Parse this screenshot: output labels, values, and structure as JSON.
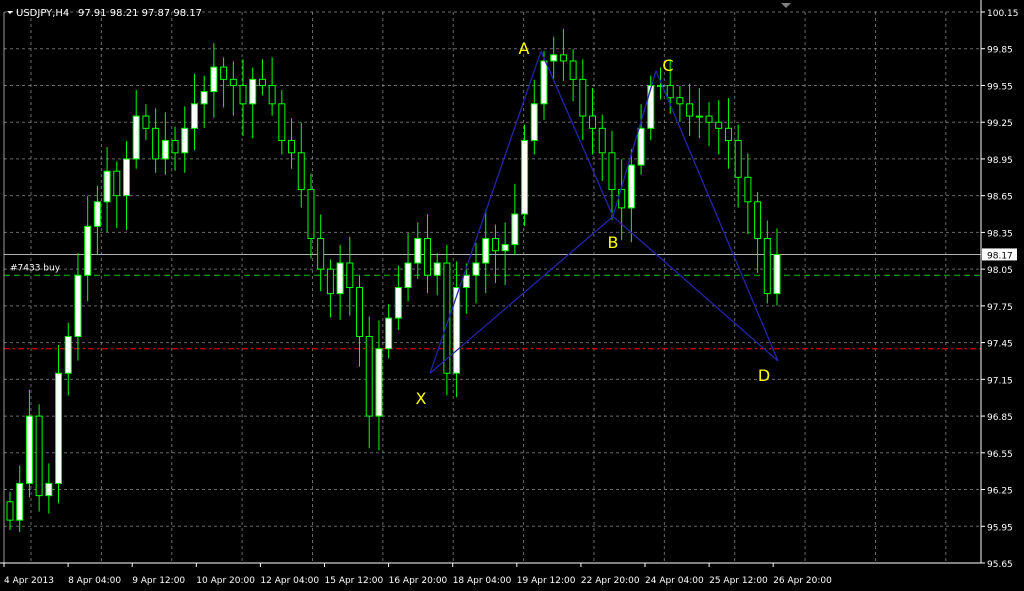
{
  "header": {
    "symbol_timeframe": "USDJPY,H4",
    "ohlc": "97.91 98.21 97.87 98.17"
  },
  "colors": {
    "background": "#000000",
    "grid": "#c0c0c0",
    "axis": "#ffffff",
    "bull_candle": "#ffffff",
    "bear_candle": "#000000",
    "wick": "#00ff00",
    "pattern": "#2424a8",
    "point_label": "#ffff00",
    "bid_line": "#b0b0b0",
    "order_line": "#00c000",
    "stop_line": "#ff0000"
  },
  "chart_data": {
    "type": "candlestick",
    "symbol": "USDJPY",
    "timeframe": "H4",
    "y_axis": {
      "min": 95.65,
      "max": 100.15,
      "ticks": [
        "100.15",
        "99.85",
        "99.55",
        "99.25",
        "98.95",
        "98.65",
        "98.35",
        "98.05",
        "97.75",
        "97.45",
        "97.15",
        "96.85",
        "96.55",
        "96.25",
        "95.95",
        "95.65"
      ],
      "current_price": "98.17"
    },
    "x_axis": {
      "labels": [
        "4 Apr 2013",
        "8 Apr 04:00",
        "9 Apr 12:00",
        "10 Apr 20:00",
        "12 Apr 04:00",
        "15 Apr 12:00",
        "16 Apr 20:00",
        "18 Apr 04:00",
        "19 Apr 12:00",
        "22 Apr 20:00",
        "24 Apr 04:00",
        "25 Apr 12:00",
        "26 Apr 20:00"
      ]
    },
    "grid": true,
    "close_path": [
      96.0,
      96.3,
      96.85,
      96.2,
      96.3,
      97.2,
      97.5,
      98.0,
      98.4,
      98.6,
      98.85,
      98.65,
      98.95,
      99.3,
      99.2,
      98.95,
      99.1,
      99.0,
      99.2,
      99.4,
      99.5,
      99.7,
      99.6,
      99.55,
      99.4,
      99.6,
      99.55,
      99.4,
      99.1,
      99.0,
      98.7,
      98.3,
      98.05,
      97.85,
      98.1,
      97.9,
      97.5,
      96.85,
      97.4,
      97.65,
      97.9,
      98.1,
      98.3,
      98.0,
      98.1,
      97.2,
      97.9,
      98.0,
      98.1,
      98.3,
      98.2,
      98.25,
      98.5,
      99.1,
      99.4,
      99.75,
      99.8,
      99.75,
      99.6,
      99.3,
      99.2,
      99.0,
      98.7,
      98.55,
      98.9,
      99.2,
      99.55,
      99.55,
      99.45,
      99.4,
      99.3,
      99.3,
      99.25,
      99.2,
      99.1,
      98.8,
      98.6,
      98.3,
      97.85,
      98.17
    ],
    "stop_loss_line": 97.4,
    "buy_order": {
      "label": "#7433 buy",
      "price": 98.0
    },
    "harmonic_pattern": {
      "points": [
        {
          "label": "X",
          "price": 97.2
        },
        {
          "label": "A",
          "price": 99.83
        },
        {
          "label": "B",
          "price": 98.48
        },
        {
          "label": "C",
          "price": 99.67
        },
        {
          "label": "D",
          "price": 97.3
        }
      ]
    }
  }
}
